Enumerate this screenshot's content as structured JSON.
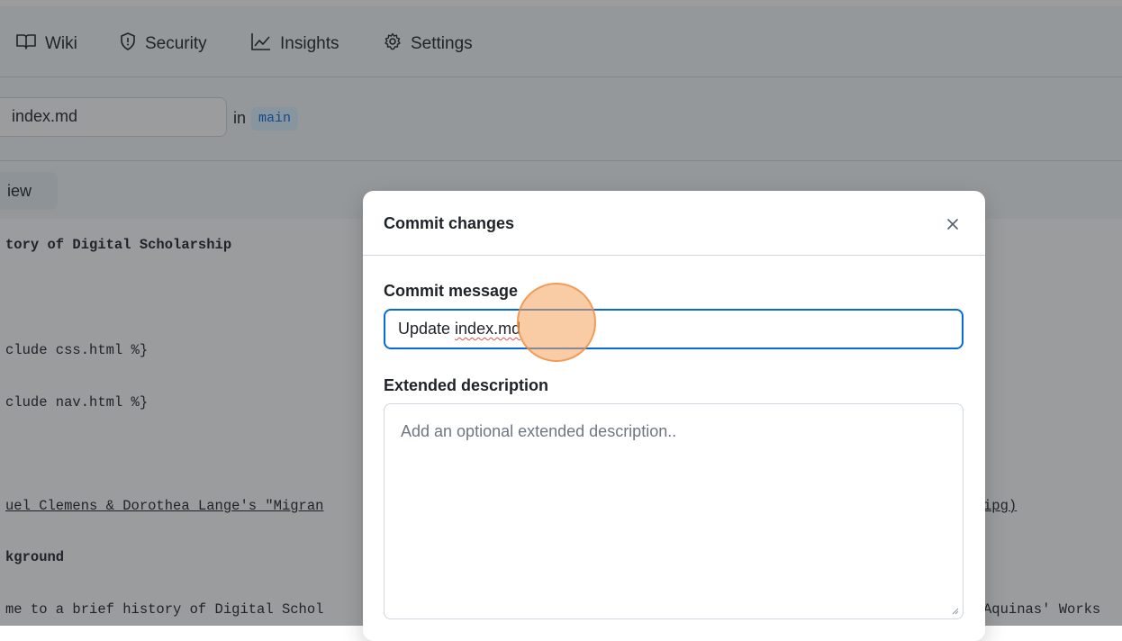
{
  "nav": {
    "items": [
      {
        "label": "Wiki",
        "icon": "book-icon"
      },
      {
        "label": "Security",
        "icon": "shield-icon"
      },
      {
        "label": "Insights",
        "icon": "graph-icon"
      },
      {
        "label": "Settings",
        "icon": "gear-icon"
      }
    ]
  },
  "editor": {
    "filename": "index.md",
    "in_label": "in",
    "branch": "main",
    "preview_tab": "iew",
    "code_lines": [
      "tory of Digital Scholarship",
      "clude css.html %}",
      "clude nav.html %}",
      "uel Clemens & Dorothea Lange's \"Migran",
      "ipg)",
      "kground",
      "me to a brief history of Digital Schol",
      "Aquinas' Works"
    ]
  },
  "dialog": {
    "title": "Commit changes",
    "close_icon": "close-icon",
    "commit_message_label": "Commit message",
    "commit_message_prefix": "Update ",
    "commit_message_word": "index.md",
    "extended_description_label": "Extended description",
    "extended_description_placeholder": "Add an optional extended description.."
  },
  "colors": {
    "accent": "#0969da",
    "branch_bg": "#ddf4ff",
    "cursor_highlight": "#f4a35c",
    "backdrop": "#1f2328"
  }
}
